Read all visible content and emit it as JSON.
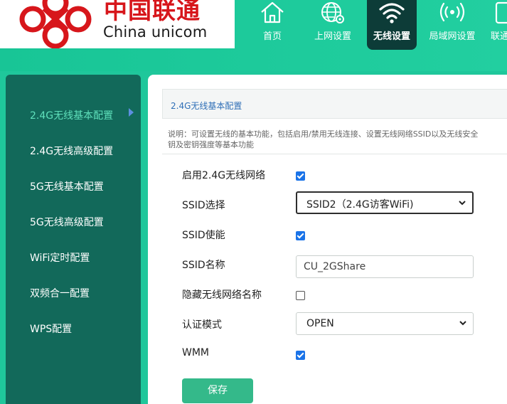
{
  "brand": {
    "name_cn": "中国联通",
    "name_en": "China unicom"
  },
  "nav": [
    {
      "label": "首页",
      "icon": "home-icon"
    },
    {
      "label": "上网设置",
      "icon": "globe-settings-icon"
    },
    {
      "label": "无线设置",
      "icon": "wifi-icon",
      "active": true
    },
    {
      "label": "局域网设置",
      "icon": "signal-broadcast-icon"
    },
    {
      "label": "联通",
      "icon": "phone-icon"
    }
  ],
  "sidebar": {
    "items": [
      {
        "label": "2.4G无线基本配置",
        "active": true
      },
      {
        "label": "2.4G无线高级配置"
      },
      {
        "label": "5G无线基本配置"
      },
      {
        "label": "5G无线高级配置"
      },
      {
        "label": "WiFi定时配置"
      },
      {
        "label": "双频合一配置"
      },
      {
        "label": "WPS配置"
      }
    ]
  },
  "main": {
    "section_title": "2.4G无线基本配置",
    "description": "说明：可设置无线的基本功能，包括启用/禁用无线连接、设置无线网络SSID以及无线安全\n钥及密钥强度等基本功能",
    "form": {
      "enable_label": "启用2.4G无线网络",
      "enable_checked": true,
      "ssid_select_label": "SSID选择",
      "ssid_select_value": "SSID2（2.4G访客WiFi)",
      "ssid_enable_label": "SSID使能",
      "ssid_enable_checked": true,
      "ssid_name_label": "SSID名称",
      "ssid_name_value": "CU_2GShare",
      "hide_ssid_label": "隐藏无线网络名称",
      "hide_ssid_checked": false,
      "auth_mode_label": "认证模式",
      "auth_mode_value": "OPEN",
      "wmm_label": "WMM",
      "wmm_checked": true
    },
    "save_label": "保存"
  },
  "colors": {
    "header": "#1fc79b",
    "nav_active": "#0d3c38",
    "sidebar": "#12695a",
    "sidebar_active_text": "#5fe0bb",
    "save_button": "#34b98a",
    "checkbox": "#1a73e8",
    "logo_red": "#d7161b"
  }
}
